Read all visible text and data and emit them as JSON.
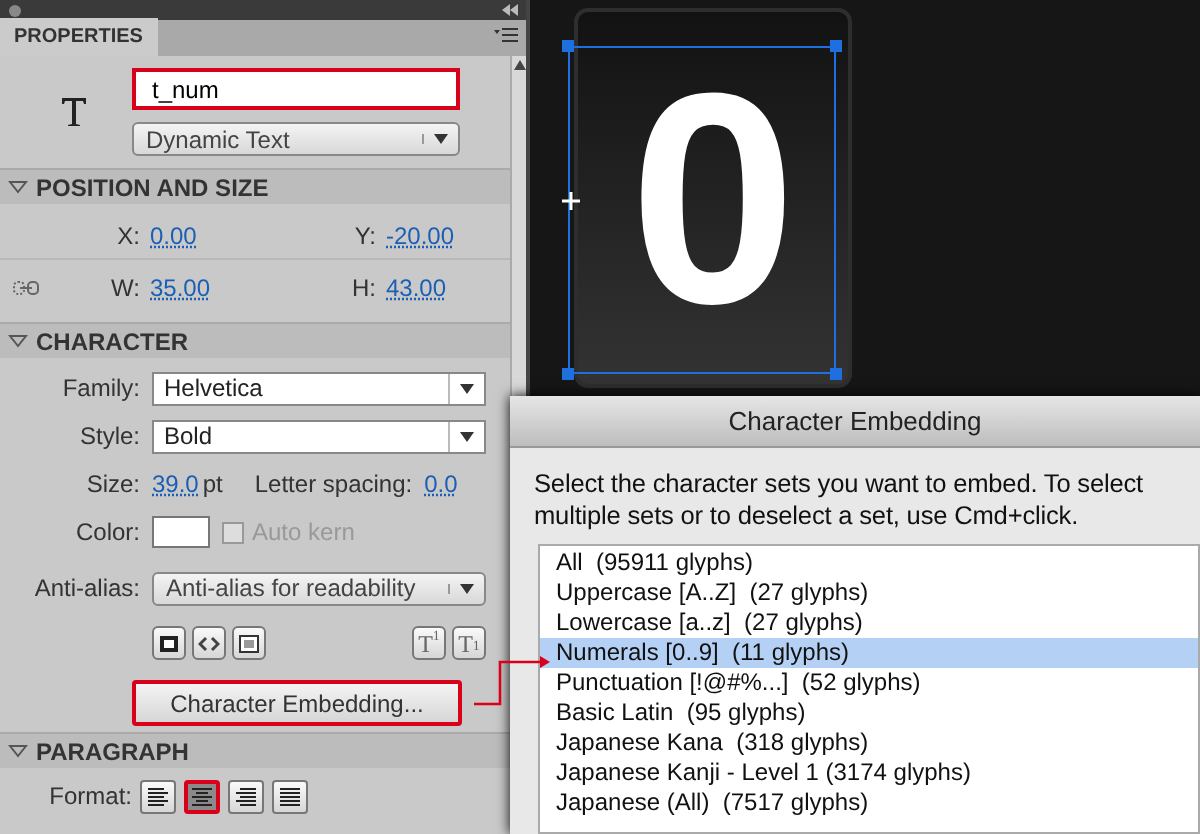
{
  "panel": {
    "tab": "PROPERTIES",
    "instance_name": {
      "value": "t_num",
      "highlighted": true
    },
    "text_type": "Dynamic Text"
  },
  "position_size": {
    "title": "POSITION AND SIZE",
    "expanded": true,
    "rows": [
      [
        {
          "label": "X:",
          "value": "0.00"
        },
        {
          "label": "Y:",
          "value": "-20.00"
        }
      ],
      [
        {
          "label": "W:",
          "value": "35.00"
        },
        {
          "label": "H:",
          "value": "43.00"
        }
      ]
    ]
  },
  "character": {
    "title": "CHARACTER",
    "expanded": true,
    "family_label": "Family:",
    "family": "Helvetica",
    "style_label": "Style:",
    "style": "Bold",
    "size_label": "Size:",
    "size": "39.0",
    "size_unit": "pt",
    "spacing_label": "Letter spacing:",
    "spacing": "0.0",
    "color_label": "Color:",
    "color": "#ffffff",
    "auto_kern": {
      "label": "Auto kern",
      "checked": false,
      "disabled": true
    },
    "antialias_label": "Anti-alias:",
    "antialias": "Anti-alias for readability",
    "toggles": [
      {
        "kind": "selectable"
      },
      {
        "kind": "html"
      },
      {
        "kind": "border"
      }
    ],
    "script_buttons": [
      {
        "label": "T$^{1}$"
      },
      {
        "label": "T$_{1}$"
      }
    ],
    "embed_button": {
      "label": "Character Embedding...",
      "highlighted": true
    }
  },
  "paragraph": {
    "title": "PARAGRAPH",
    "expanded": true,
    "format_label": "Format:",
    "alignments": [
      {
        "kind": "left",
        "selected": false,
        "highlighted": false
      },
      {
        "kind": "center",
        "selected": true,
        "highlighted": true
      },
      {
        "kind": "right",
        "selected": false,
        "highlighted": false
      },
      {
        "kind": "justify",
        "selected": false,
        "highlighted": false
      }
    ]
  },
  "stage": {
    "digit": "0"
  },
  "dialog": {
    "title": "Character Embedding",
    "instructions": "Select the character sets you want to embed. To select multiple sets or to deselect a set, use Cmd+click.",
    "sets": [
      {
        "label": "All  (95911 glyphs)",
        "selected": false
      },
      {
        "label": "Uppercase [A..Z]  (27 glyphs)",
        "selected": false
      },
      {
        "label": "Lowercase [a..z]  (27 glyphs)",
        "selected": false
      },
      {
        "label": "Numerals [0..9]  (11 glyphs)",
        "selected": true
      },
      {
        "label": "Punctuation [!@#%...]  (52 glyphs)",
        "selected": false
      },
      {
        "label": "Basic Latin  (95 glyphs)",
        "selected": false
      },
      {
        "label": "Japanese Kana  (318 glyphs)",
        "selected": false
      },
      {
        "label": "Japanese Kanji - Level 1 (3174 glyphs)",
        "selected": false
      },
      {
        "label": "Japanese (All)  (7517 glyphs)",
        "selected": false
      }
    ]
  }
}
